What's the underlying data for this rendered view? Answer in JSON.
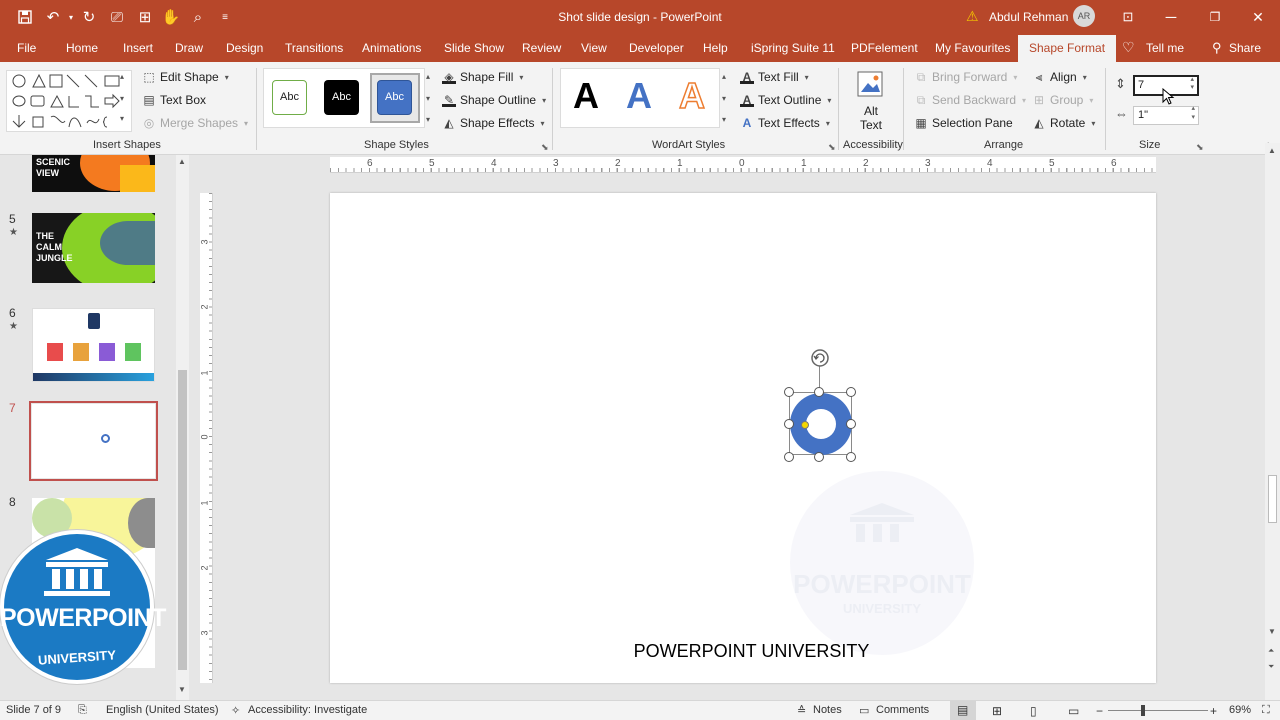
{
  "window": {
    "doc_title": "Shot slide design",
    "app_name": "PowerPoint",
    "title_separator": " - ",
    "user_name": "Abdul Rehman",
    "user_initials": "AR"
  },
  "tabs": [
    "File",
    "Home",
    "Insert",
    "Draw",
    "Design",
    "Transitions",
    "Animations",
    "Slide Show",
    "Review",
    "View",
    "Developer",
    "Help",
    "iSpring Suite 11",
    "PDFelement",
    "My Favourites",
    "Shape Format"
  ],
  "active_tab": "Shape Format",
  "tell_me": "Tell me",
  "share": "Share",
  "ribbon": {
    "insert_shapes": {
      "label": "Insert Shapes",
      "edit_shape": "Edit Shape",
      "text_box": "Text Box",
      "merge_shapes": "Merge Shapes"
    },
    "shape_styles": {
      "label": "Shape Styles",
      "preset_text": "Abc",
      "shape_fill": "Shape Fill",
      "shape_outline": "Shape Outline",
      "shape_effects": "Shape Effects"
    },
    "wordart": {
      "label": "WordArt Styles",
      "glyph": "A",
      "text_fill": "Text Fill",
      "text_outline": "Text Outline",
      "text_effects": "Text Effects"
    },
    "accessibility": {
      "label": "Accessibility",
      "alt_text_line1": "Alt",
      "alt_text_line2": "Text"
    },
    "arrange": {
      "label": "Arrange",
      "bring_forward": "Bring Forward",
      "send_backward": "Send Backward",
      "selection_pane": "Selection Pane",
      "align": "Align",
      "group": "Group",
      "rotate": "Rotate"
    },
    "size": {
      "label": "Size",
      "height_value": "7",
      "width_value": "1\""
    }
  },
  "slides": [
    {
      "number": "",
      "title": "SCENIC VIEW",
      "starred": false
    },
    {
      "number": "5",
      "title": "THE CALM JUNGLE",
      "starred": true
    },
    {
      "number": "6",
      "title": "",
      "starred": true
    },
    {
      "number": "7",
      "title": "",
      "starred": false,
      "selected": true
    },
    {
      "number": "8",
      "title": "",
      "starred": false
    }
  ],
  "ruler": {
    "horizontal": [
      "6",
      "5",
      "4",
      "3",
      "2",
      "1",
      "0",
      "1",
      "2",
      "3",
      "4",
      "5",
      "6"
    ],
    "vertical": [
      "3",
      "2",
      "1",
      "0",
      "1",
      "2",
      "3"
    ]
  },
  "slide_content": {
    "footer_text": "POWERPOINT UNIVERSITY",
    "watermark_line1": "POWERPOINT",
    "watermark_line2": "UNIVERSITY"
  },
  "logo": {
    "line1": "POWERPOINT",
    "line2": "UNIVERSITY"
  },
  "status": {
    "slide_info": "Slide 7 of 9",
    "language": "English (United States)",
    "accessibility": "Accessibility: Investigate",
    "notes": "Notes",
    "comments": "Comments",
    "zoom": "69%"
  },
  "colors": {
    "accent": "#b7472a",
    "shape_blue": "#4472c4",
    "selection_red": "#c0504d"
  }
}
